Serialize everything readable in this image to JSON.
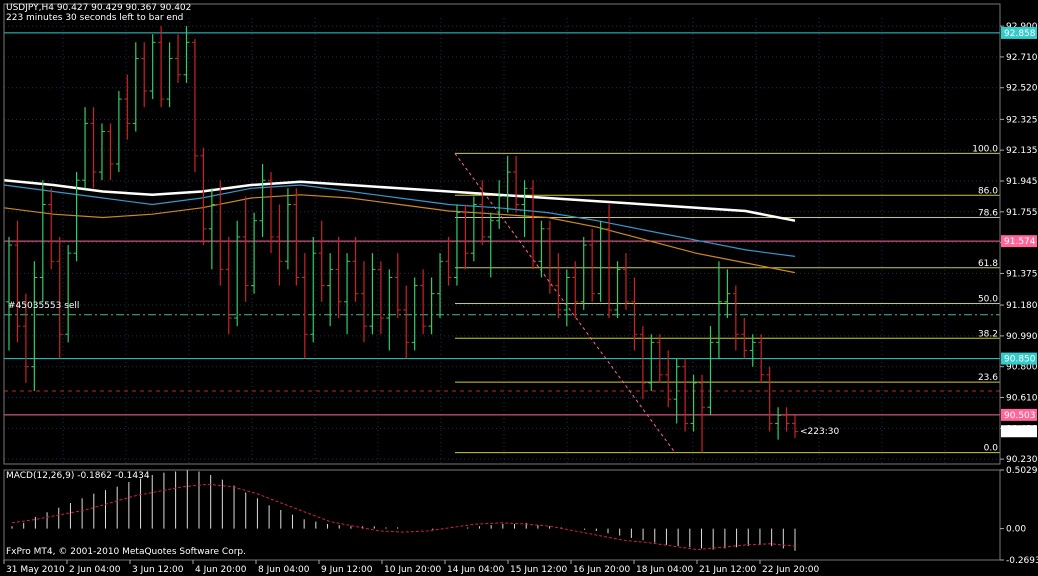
{
  "header": {
    "symbol_line": "USDJPY,H4  90.427 90.429 90.367 90.402",
    "timer_line": "223 minutes 30 seconds left to bar end"
  },
  "footer": {
    "copyright": "FxPro MT4, © 2001-2010 MetaQuotes Software Corp."
  },
  "order_label": "#45035553 sell",
  "countdown_label": "<223:30",
  "colors": {
    "background": "#000000",
    "grid": "#1c2f4f",
    "bull": "#33cc66",
    "bear": "#cc2222",
    "fib": "#cccc33",
    "ma_white": "#ffffff",
    "ma_blue": "#3399cc",
    "ma_orange": "#cc8822",
    "cyan_line": "#33cccc",
    "pink_line": "#ff6699",
    "macd_signal": "#cc2244",
    "countdown": "#cc33cc"
  },
  "chart_data": [
    {
      "type": "candlestick",
      "title": "USDJPY,H4",
      "price_axis_ticks": [
        "92.900",
        "92.710",
        "92.520",
        "92.325",
        "92.135",
        "91.945",
        "91.755",
        "91.565",
        "91.375",
        "91.180",
        "90.990",
        "90.800",
        "90.610",
        "90.420",
        "90.230"
      ],
      "time_axis_ticks": [
        "31 May 2010",
        "2 Jun 04:00",
        "3 Jun 12:00",
        "4 Jun 20:00",
        "8 Jun 04:00",
        "9 Jun 12:00",
        "10 Jun 20:00",
        "14 Jun 04:00",
        "15 Jun 12:00",
        "16 Jun 20:00",
        "18 Jun 04:00",
        "21 Jun 12:00",
        "22 Jun 20:00"
      ],
      "ylim": [
        90.2,
        92.95
      ],
      "price_markers": [
        {
          "label": "92.858",
          "value": 92.858,
          "kind": "cyan"
        },
        {
          "label": "91.574",
          "value": 91.574,
          "kind": "pink"
        },
        {
          "label": "90.850",
          "value": 90.85,
          "kind": "cyan"
        },
        {
          "label": "90.503",
          "value": 90.503,
          "kind": "pink"
        },
        {
          "label": "90.402",
          "value": 90.402,
          "kind": "current"
        }
      ],
      "horizontal_lines": [
        {
          "value": 92.858,
          "style": "cyan-solid"
        },
        {
          "value": 91.574,
          "style": "pink-solid"
        },
        {
          "value": 90.85,
          "style": "cyan-solid"
        },
        {
          "value": 90.503,
          "style": "pink-solid"
        },
        {
          "value": 91.12,
          "style": "green-dashdot"
        },
        {
          "value": 90.65,
          "style": "red-dashed"
        }
      ],
      "fibonacci": {
        "high": 92.115,
        "low": 90.27,
        "levels": [
          {
            "label": "100.0",
            "value": 92.115
          },
          {
            "label": "86.0",
            "value": 91.857
          },
          {
            "label": "78.6",
            "value": 91.72
          },
          {
            "label": "61.8",
            "value": 91.41
          },
          {
            "label": "50.0",
            "value": 91.19
          },
          {
            "label": "38.2",
            "value": 90.975
          },
          {
            "label": "23.6",
            "value": 90.705
          },
          {
            "label": "0.0",
            "value": 90.27
          }
        ]
      },
      "candles": [
        [
          91.2,
          91.6,
          90.9,
          91.55
        ],
        [
          91.55,
          91.7,
          90.95,
          91.05
        ],
        [
          91.05,
          91.25,
          90.7,
          90.8
        ],
        [
          90.8,
          91.45,
          90.65,
          91.35
        ],
        [
          91.35,
          91.95,
          91.2,
          91.8
        ],
        [
          91.8,
          91.9,
          91.4,
          91.45
        ],
        [
          91.45,
          91.6,
          90.85,
          91.0
        ],
        [
          91.0,
          91.55,
          90.95,
          91.5
        ],
        [
          91.5,
          92.0,
          91.45,
          91.95
        ],
        [
          91.95,
          92.4,
          91.9,
          92.3
        ],
        [
          92.3,
          92.4,
          91.9,
          92.0
        ],
        [
          92.0,
          92.3,
          91.95,
          92.25
        ],
        [
          92.25,
          92.3,
          91.95,
          92.05
        ],
        [
          92.05,
          92.5,
          92.0,
          92.45
        ],
        [
          92.45,
          92.6,
          92.2,
          92.3
        ],
        [
          92.3,
          92.8,
          92.25,
          92.7
        ],
        [
          92.7,
          92.8,
          92.4,
          92.5
        ],
        [
          92.5,
          92.85,
          92.45,
          92.8
        ],
        [
          92.8,
          92.9,
          92.4,
          92.45
        ],
        [
          92.45,
          92.8,
          92.4,
          92.7
        ],
        [
          92.7,
          92.85,
          92.55,
          92.6
        ],
        [
          92.6,
          92.9,
          92.55,
          92.8
        ],
        [
          92.8,
          92.82,
          92.0,
          92.1
        ],
        [
          92.1,
          92.15,
          91.55,
          91.65
        ],
        [
          91.65,
          91.9,
          91.4,
          91.8
        ],
        [
          91.8,
          91.95,
          91.3,
          91.4
        ],
        [
          91.4,
          91.6,
          91.0,
          91.1
        ],
        [
          91.1,
          91.7,
          91.05,
          91.6
        ],
        [
          91.6,
          91.85,
          91.2,
          91.3
        ],
        [
          91.3,
          91.75,
          91.25,
          91.7
        ],
        [
          91.7,
          92.05,
          91.6,
          91.95
        ],
        [
          91.95,
          92.0,
          91.5,
          91.6
        ],
        [
          91.6,
          91.8,
          91.3,
          91.45
        ],
        [
          91.45,
          91.9,
          91.4,
          91.8
        ],
        [
          91.8,
          91.9,
          91.3,
          91.35
        ],
        [
          91.35,
          91.5,
          90.85,
          91.0
        ],
        [
          91.0,
          91.6,
          90.95,
          91.5
        ],
        [
          91.5,
          91.7,
          91.2,
          91.3
        ],
        [
          91.3,
          91.5,
          91.05,
          91.4
        ],
        [
          91.4,
          91.6,
          91.1,
          91.2
        ],
        [
          91.2,
          91.5,
          91.0,
          91.45
        ],
        [
          91.45,
          91.6,
          91.2,
          91.25
        ],
        [
          91.25,
          91.45,
          90.95,
          91.05
        ],
        [
          91.05,
          91.5,
          91.0,
          91.4
        ],
        [
          91.4,
          91.45,
          91.0,
          91.1
        ],
        [
          91.1,
          91.4,
          90.9,
          91.35
        ],
        [
          91.35,
          91.5,
          91.1,
          91.15
        ],
        [
          91.15,
          91.3,
          90.85,
          90.95
        ],
        [
          90.95,
          91.35,
          90.9,
          91.3
        ],
        [
          91.3,
          91.4,
          91.0,
          91.05
        ],
        [
          91.05,
          91.35,
          91.0,
          91.25
        ],
        [
          91.25,
          91.5,
          91.1,
          91.45
        ],
        [
          91.45,
          91.6,
          91.3,
          91.35
        ],
        [
          91.35,
          91.8,
          91.3,
          91.75
        ],
        [
          91.75,
          91.8,
          91.4,
          91.5
        ],
        [
          91.5,
          91.85,
          91.45,
          91.8
        ],
        [
          91.8,
          91.95,
          91.55,
          91.6
        ],
        [
          91.6,
          91.75,
          91.35,
          91.7
        ],
        [
          91.7,
          91.95,
          91.65,
          91.85
        ],
        [
          91.85,
          92.1,
          91.75,
          92.0
        ],
        [
          92.0,
          92.1,
          91.75,
          91.8
        ],
        [
          91.8,
          91.95,
          91.6,
          91.9
        ],
        [
          91.9,
          91.95,
          91.4,
          91.45
        ],
        [
          91.45,
          91.7,
          91.35,
          91.65
        ],
        [
          91.65,
          91.7,
          91.25,
          91.3
        ],
        [
          91.3,
          91.5,
          91.1,
          91.15
        ],
        [
          91.15,
          91.4,
          91.05,
          91.35
        ],
        [
          91.35,
          91.45,
          91.1,
          91.2
        ],
        [
          91.2,
          91.6,
          91.15,
          91.55
        ],
        [
          91.55,
          91.65,
          91.2,
          91.25
        ],
        [
          91.25,
          91.7,
          91.2,
          91.65
        ],
        [
          91.65,
          91.8,
          91.1,
          91.15
        ],
        [
          91.15,
          91.45,
          91.1,
          91.4
        ],
        [
          91.4,
          91.5,
          91.15,
          91.2
        ],
        [
          91.2,
          91.35,
          90.9,
          91.0
        ],
        [
          91.0,
          91.05,
          90.6,
          90.7
        ],
        [
          90.7,
          91.0,
          90.65,
          90.95
        ],
        [
          90.95,
          91.0,
          90.7,
          90.75
        ],
        [
          90.75,
          90.9,
          90.55,
          90.6
        ],
        [
          90.6,
          90.85,
          90.45,
          90.8
        ],
        [
          90.8,
          90.85,
          90.4,
          90.45
        ],
        [
          90.45,
          90.75,
          90.4,
          90.7
        ],
        [
          90.7,
          90.75,
          90.27,
          90.55
        ],
        [
          90.55,
          91.05,
          90.5,
          90.95
        ],
        [
          90.95,
          91.45,
          90.85,
          91.2
        ],
        [
          91.2,
          91.4,
          91.1,
          91.25
        ],
        [
          91.25,
          91.3,
          90.9,
          91.0
        ],
        [
          91.0,
          91.1,
          90.85,
          90.9
        ],
        [
          90.9,
          91.0,
          90.8,
          90.95
        ],
        [
          90.95,
          91.0,
          90.7,
          90.75
        ],
        [
          90.75,
          90.8,
          90.4,
          90.45
        ],
        [
          90.45,
          90.55,
          90.35,
          90.5
        ],
        [
          90.5,
          90.55,
          90.4,
          90.45
        ],
        [
          90.45,
          90.5,
          90.36,
          90.4
        ]
      ],
      "moving_averages": [
        {
          "name": "white",
          "values": [
            91.95,
            91.92,
            91.88,
            91.86,
            91.88,
            91.92,
            91.94,
            91.92,
            91.9,
            91.88,
            91.86,
            91.84,
            91.82,
            91.8,
            91.78,
            91.76,
            91.7
          ]
        },
        {
          "name": "blue",
          "values": [
            91.92,
            91.88,
            91.84,
            91.8,
            91.84,
            91.9,
            91.92,
            91.88,
            91.84,
            91.8,
            91.78,
            91.75,
            91.7,
            91.64,
            91.58,
            91.52,
            91.48
          ]
        },
        {
          "name": "orange",
          "values": [
            91.78,
            91.74,
            91.72,
            91.74,
            91.78,
            91.84,
            91.86,
            91.84,
            91.8,
            91.76,
            91.74,
            91.72,
            91.66,
            91.58,
            91.5,
            91.44,
            91.38
          ]
        }
      ]
    },
    {
      "type": "bar",
      "title": "MACD(12,26,9) -0.1862 -0.1434",
      "ylabel_ticks": [
        "0.5029",
        "0.00",
        "-0.2693"
      ],
      "ylim": [
        -0.2693,
        0.5029
      ],
      "macd_values": [
        0.02,
        0.05,
        0.1,
        0.14,
        0.18,
        0.22,
        0.26,
        0.3,
        0.33,
        0.36,
        0.4,
        0.43,
        0.46,
        0.48,
        0.49,
        0.5,
        0.49,
        0.46,
        0.42,
        0.37,
        0.31,
        0.26,
        0.2,
        0.16,
        0.12,
        0.08,
        0.06,
        0.04,
        0.03,
        0.02,
        0.02,
        0.02,
        0.01,
        0.01,
        0.0,
        0.0,
        -0.01,
        0.0,
        0.0,
        0.01,
        0.02,
        0.03,
        0.04,
        0.04,
        0.05,
        0.03,
        0.02,
        0.01,
        0.0,
        -0.01,
        -0.02,
        -0.04,
        -0.06,
        -0.08,
        -0.1,
        -0.12,
        -0.14,
        -0.15,
        -0.16,
        -0.17,
        -0.18,
        -0.17,
        -0.16,
        -0.15,
        -0.14,
        -0.15,
        -0.17,
        -0.19
      ],
      "signal_values": [
        0.05,
        0.08,
        0.12,
        0.16,
        0.22,
        0.28,
        0.32,
        0.36,
        0.38,
        0.36,
        0.3,
        0.22,
        0.14,
        0.06,
        0.02,
        -0.02,
        -0.03,
        -0.02,
        0.01,
        0.04,
        0.05,
        0.04,
        0.02,
        -0.02,
        -0.06,
        -0.1,
        -0.12,
        -0.15,
        -0.18,
        -0.16,
        -0.14,
        -0.13,
        -0.15
      ]
    }
  ]
}
